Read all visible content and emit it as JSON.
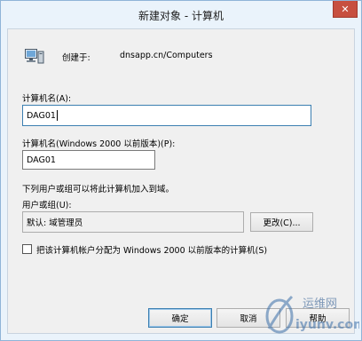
{
  "window": {
    "title": "新建对象 - 计算机",
    "close_glyph": "✕"
  },
  "header": {
    "created_in_label": "创建于:",
    "created_in_value": "dnsapp.cn/Computers"
  },
  "form": {
    "computer_name_label": "计算机名(A):",
    "computer_name_value": "DAG01",
    "pre2000_label": "计算机名(Windows 2000 以前版本)(P):",
    "pre2000_value": "DAG01",
    "join_domain_text": "下列用户或组可以将此计算机加入到域。",
    "user_group_label": "用户或组(U):",
    "user_group_value": "默认: 域管理员",
    "change_button": "更改(C)...",
    "assign_checkbox_label": "把该计算机帐户分配为 Windows 2000 以前版本的计算机(S)",
    "assign_checkbox_checked": false
  },
  "buttons": {
    "ok": "确定",
    "cancel": "取消",
    "help": "帮助"
  },
  "watermark": {
    "brand": "运维网",
    "url": "iyunv.com"
  },
  "colors": {
    "title_bar": "#eaf3fb",
    "close_button": "#c7503f",
    "accent": "#3c7fb1"
  }
}
